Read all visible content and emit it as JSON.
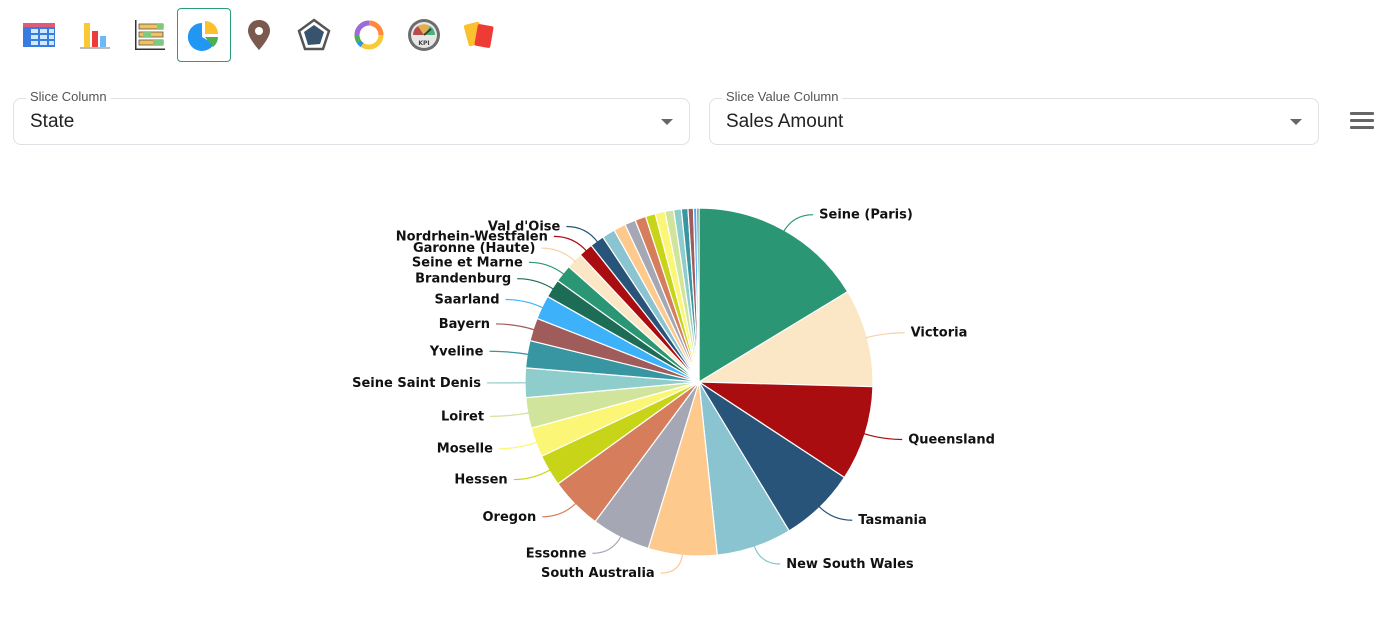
{
  "toolbar": {
    "buttons": [
      {
        "name": "table-view",
        "icon": "table-icon",
        "active": false
      },
      {
        "name": "bar-chart-view",
        "icon": "bar-chart-icon",
        "active": false
      },
      {
        "name": "gantt-view",
        "icon": "gantt-chart-icon",
        "active": false
      },
      {
        "name": "pie-chart-view",
        "icon": "pie-chart-icon",
        "active": true
      },
      {
        "name": "map-view",
        "icon": "map-pin-icon",
        "active": false
      },
      {
        "name": "radar-view",
        "icon": "radar-chart-icon",
        "active": false
      },
      {
        "name": "donut-view",
        "icon": "donut-chart-icon",
        "active": false
      },
      {
        "name": "kpi-view",
        "icon": "kpi-gauge-icon",
        "active": false
      },
      {
        "name": "cards-view",
        "icon": "cards-icon",
        "active": false
      }
    ]
  },
  "controls": {
    "slice_column": {
      "label": "Slice Column",
      "value": "State"
    },
    "slice_value_column": {
      "label": "Slice Value Column",
      "value": "Sales Amount"
    },
    "menu_icon": "hamburger-menu-icon"
  },
  "chart_data": {
    "type": "pie",
    "title": "",
    "value_label": "Sales Amount",
    "slices": [
      {
        "label": "Seine (Paris)",
        "value": 16.1,
        "color": "#2a9673",
        "labeled": true
      },
      {
        "label": "Victoria",
        "value": 9.0,
        "color": "#fbe6c5",
        "labeled": true
      },
      {
        "label": "Queensland",
        "value": 8.7,
        "color": "#a90d0f",
        "labeled": true
      },
      {
        "label": "Tasmania",
        "value": 7.0,
        "color": "#28547a",
        "labeled": true
      },
      {
        "label": "New South Wales",
        "value": 6.9,
        "color": "#8ac4d0",
        "labeled": true
      },
      {
        "label": "South Australia",
        "value": 6.3,
        "color": "#fec98d",
        "labeled": true
      },
      {
        "label": "Essonne",
        "value": 5.4,
        "color": "#a5a8b4",
        "labeled": true
      },
      {
        "label": "Oregon",
        "value": 4.8,
        "color": "#d67e5c",
        "labeled": true
      },
      {
        "label": "Hessen",
        "value": 2.9,
        "color": "#c8d418",
        "labeled": true
      },
      {
        "label": "Moselle",
        "value": 2.7,
        "color": "#fcf676",
        "labeled": true
      },
      {
        "label": "Loiret",
        "value": 2.8,
        "color": "#d0e49c",
        "labeled": true
      },
      {
        "label": "Seine Saint Denis",
        "value": 2.7,
        "color": "#8ecdcb",
        "labeled": true
      },
      {
        "label": "Yveline",
        "value": 2.5,
        "color": "#3895a2",
        "labeled": true
      },
      {
        "label": "Bayern",
        "value": 2.1,
        "color": "#a05b5b",
        "labeled": true
      },
      {
        "label": "Saarland",
        "value": 2.2,
        "color": "#3eb1fb",
        "labeled": true
      },
      {
        "label": "Brandenburg",
        "value": 1.7,
        "color": "#1d6c56",
        "labeled": true
      },
      {
        "label": "Seine et Marne",
        "value": 1.6,
        "color": "#2a9673",
        "labeled": true
      },
      {
        "label": "Garonne (Haute)",
        "value": 1.5,
        "color": "#fbe6c5",
        "labeled": true
      },
      {
        "label": "Nordrhein-Westfalen",
        "value": 1.3,
        "color": "#a90d0f",
        "labeled": true
      },
      {
        "label": "Val d'Oise",
        "value": 1.3,
        "color": "#28547a",
        "labeled": true
      },
      {
        "label": "",
        "value": 1.2,
        "color": "#8ac4d0",
        "labeled": false
      },
      {
        "label": "",
        "value": 1.1,
        "color": "#fec98d",
        "labeled": false
      },
      {
        "label": "",
        "value": 1.0,
        "color": "#a5a8b4",
        "labeled": false
      },
      {
        "label": "",
        "value": 1.0,
        "color": "#d67e5c",
        "labeled": false
      },
      {
        "label": "",
        "value": 0.9,
        "color": "#c8d418",
        "labeled": false
      },
      {
        "label": "",
        "value": 0.9,
        "color": "#fcf676",
        "labeled": false
      },
      {
        "label": "",
        "value": 0.8,
        "color": "#d0e49c",
        "labeled": false
      },
      {
        "label": "",
        "value": 0.7,
        "color": "#8ecdcb",
        "labeled": false
      },
      {
        "label": "",
        "value": 0.6,
        "color": "#3895a2",
        "labeled": false
      },
      {
        "label": "",
        "value": 0.5,
        "color": "#a05b5b",
        "labeled": false
      },
      {
        "label": "",
        "value": 0.3,
        "color": "#3eb1fb",
        "labeled": false
      },
      {
        "label": "",
        "value": 0.2,
        "color": "#1d6c56",
        "labeled": false
      }
    ],
    "legend": "none"
  }
}
